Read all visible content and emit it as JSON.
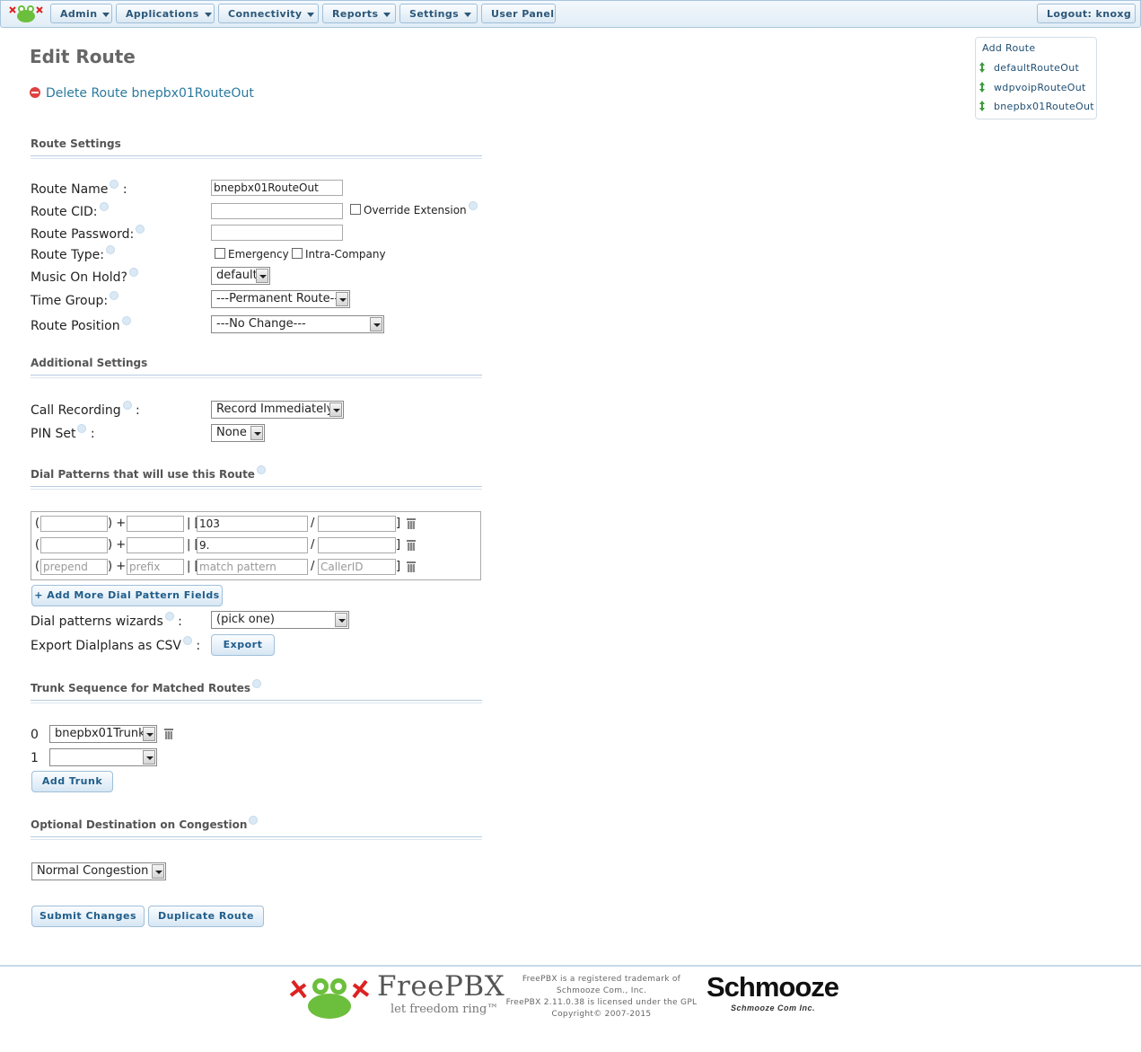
{
  "nav": {
    "menus": [
      "Admin",
      "Applications",
      "Connectivity",
      "Reports",
      "Settings"
    ],
    "user_panel": "User Panel",
    "logout": "Logout: knoxg"
  },
  "page": {
    "title": "Edit Route",
    "delete_link": "Delete Route bnepbx01RouteOut"
  },
  "sidebar": {
    "add_route": "Add Route",
    "routes": [
      "defaultRouteOut",
      "wdpvoipRouteOut",
      "bnepbx01RouteOut"
    ]
  },
  "route_settings": {
    "heading": "Route Settings",
    "route_name_label": "Route Name",
    "route_name_value": "bnepbx01RouteOut",
    "route_cid_label": "Route CID:",
    "override_extension": "Override Extension",
    "route_password_label": "Route Password:",
    "route_type_label": "Route Type:",
    "emergency": "Emergency",
    "intra_company": "Intra-Company",
    "moh_label": "Music On Hold?",
    "moh_value": "default",
    "time_group_label": "Time Group:",
    "time_group_value": "---Permanent Route---",
    "route_position_label": "Route Position",
    "route_position_value": "---No Change---"
  },
  "additional": {
    "heading": "Additional Settings",
    "call_recording_label": "Call Recording",
    "call_recording_value": "Record Immediately",
    "pin_set_label": "PIN Set",
    "pin_set_value": "None"
  },
  "dial_patterns": {
    "heading": "Dial Patterns that will use this Route",
    "rows": [
      {
        "prepend": "",
        "prefix": "",
        "match": "103",
        "callerid": ""
      },
      {
        "prepend": "",
        "prefix": "",
        "match": "9.",
        "callerid": ""
      }
    ],
    "placeholders": {
      "prepend": "prepend",
      "prefix": "prefix",
      "match": "match pattern",
      "callerid": "CallerID"
    },
    "add_more": "+ Add More Dial Pattern Fields",
    "wizards_label": "Dial patterns wizards",
    "wizards_value": "(pick one)",
    "export_label": "Export Dialplans as CSV",
    "export_button": "Export"
  },
  "trunks": {
    "heading": "Trunk Sequence for Matched Routes",
    "rows": [
      {
        "index": "0",
        "value": "bnepbx01Trunk"
      },
      {
        "index": "1",
        "value": ""
      }
    ],
    "add_trunk": "Add Trunk"
  },
  "congestion": {
    "heading": "Optional Destination on Congestion",
    "value": "Normal Congestion"
  },
  "actions": {
    "submit": "Submit Changes",
    "duplicate": "Duplicate Route"
  },
  "footer": {
    "brand": "FreePBX",
    "tagline": "let freedom ring™",
    "legal": [
      "FreePBX is a registered trademark of",
      "Schmooze Com., Inc.",
      "FreePBX 2.11.0.38 is licensed under the GPL",
      "Copyright© 2007-2015"
    ],
    "schmooze": "Schmooze",
    "schmooze_sub": "Schmooze Com Inc."
  }
}
